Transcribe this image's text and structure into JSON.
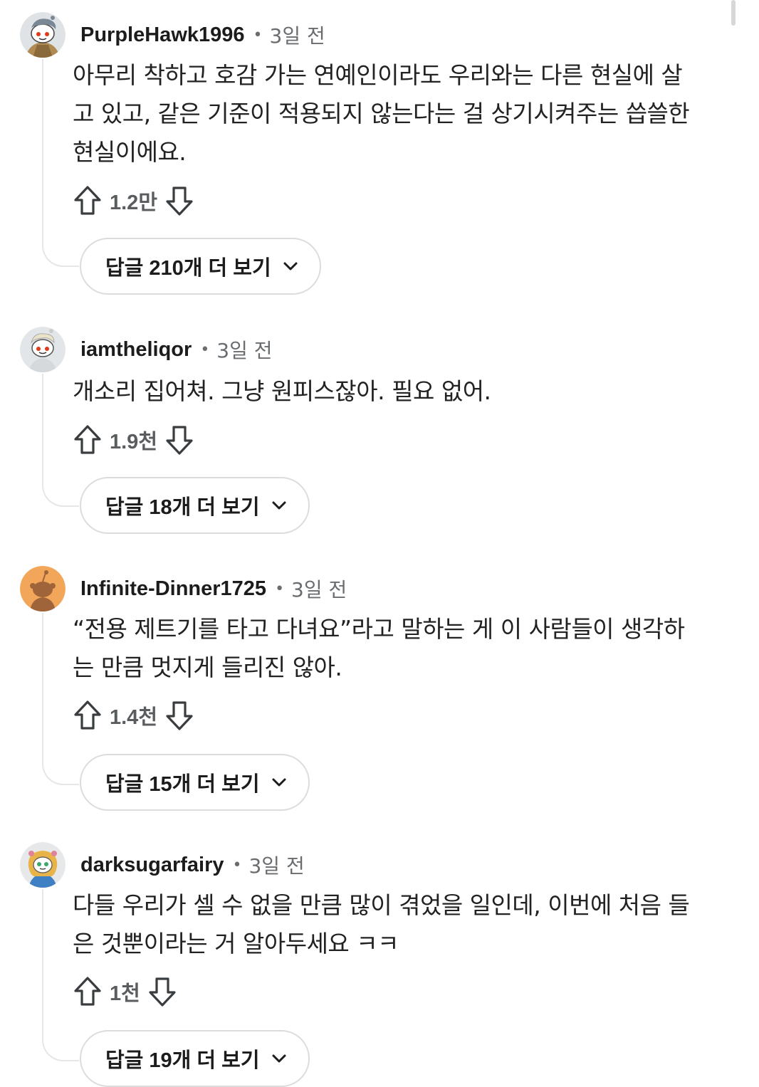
{
  "comments": [
    {
      "username": "PurpleHawk1996",
      "separator": "•",
      "time": "3일 전",
      "lines": [
        "아무리 착하고 호감 가는 연예인이라도 우리와는 다른 현실에 살",
        "고 있고, 같은 기준이 적용되지 않는다는 걸 상기시켜주는 씁쓸한",
        "현실이에요."
      ],
      "votes": "1.2만",
      "more_replies": "답글 210개 더 보기"
    },
    {
      "username": "iamtheliqor",
      "separator": "•",
      "time": "3일 전",
      "lines": [
        "개소리 집어쳐. 그냥 원피스잖아. 필요 없어."
      ],
      "votes": "1.9천",
      "more_replies": "답글 18개 더 보기"
    },
    {
      "username": "Infinite-Dinner1725",
      "separator": "•",
      "time": "3일 전",
      "lines": [
        "“전용 제트기를 타고 다녀요”라고 말하는 게 이 사람들이 생각하",
        "는 만큼 멋지게 들리진 않아."
      ],
      "votes": "1.4천",
      "more_replies": "답글 15개 더 보기"
    },
    {
      "username": "darksugarfairy",
      "separator": "•",
      "time": "3일 전",
      "lines": [
        "다들 우리가 셀 수 없을 만큼 많이 겪었을 일인데, 이번에 처음 들",
        "은 것뿐이라는 거 알아두세요 ㅋㅋ"
      ],
      "votes": "1천",
      "more_replies": "답글 19개 더 보기"
    }
  ],
  "icons": {
    "upvote": "upvote-arrow-icon",
    "downvote": "downvote-arrow-icon",
    "expand": "chevron-down-icon"
  },
  "colors": {
    "text": "#1c1c1c",
    "meta": "#6a6d70",
    "thread_line": "#e4e6e8",
    "button_border": "#dadcde"
  }
}
